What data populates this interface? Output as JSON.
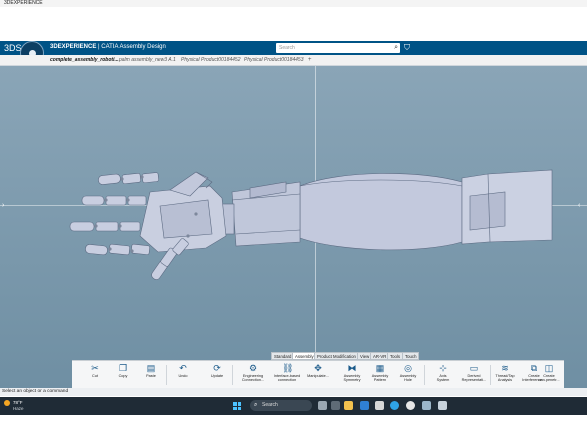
{
  "window_title": "3DEXPERIENCE",
  "header": {
    "ds_logo": "3DS",
    "brand_bold": "3DEXPERIENCE",
    "brand_rest": " | CATIA Assembly Design",
    "search_placeholder": "Search",
    "search_icon": "search-icon",
    "tag_icon": "tag-icon"
  },
  "tabs": [
    {
      "label": "complete_assembly_roboti...",
      "active": true
    },
    {
      "label": "palm assembly_new3 A.1",
      "active": false
    },
    {
      "label": "Physical Product00184452",
      "active": false
    },
    {
      "label": "Physical Product00184453",
      "active": false
    }
  ],
  "tab_add": "+",
  "action_bar_tabs": [
    "Standard",
    "Assembly",
    "Product Modification",
    "View",
    "AR-VR",
    "Tools",
    "Touch"
  ],
  "active_action_tab": "Assembly",
  "tools": [
    {
      "label": "Cut",
      "icon": "cut-icon",
      "glyph": "✂"
    },
    {
      "label": "Copy",
      "icon": "copy-icon",
      "glyph": "❐"
    },
    {
      "label": "Paste",
      "icon": "paste-icon",
      "glyph": "▤"
    },
    {
      "label": "Undo",
      "icon": "undo-icon",
      "glyph": "↶"
    },
    {
      "label": "Update",
      "icon": "update-icon",
      "glyph": "⟳"
    },
    {
      "label": "Engineering\nConnection...",
      "icon": "engineering-connection-icon",
      "glyph": "⚙"
    },
    {
      "label": "Interface-based\nconnection",
      "icon": "interface-connection-icon",
      "glyph": "⛓"
    },
    {
      "label": "Manipulate...",
      "icon": "manipulate-icon",
      "glyph": "✥"
    },
    {
      "label": "Assembly\nSymmetry",
      "icon": "assembly-symmetry-icon",
      "glyph": "⧓"
    },
    {
      "label": "Assembly\nPattern",
      "icon": "assembly-pattern-icon",
      "glyph": "▦"
    },
    {
      "label": "Assembly\nHole",
      "icon": "assembly-hole-icon",
      "glyph": "◎"
    },
    {
      "label": "Axis\nSystem",
      "icon": "axis-system-icon",
      "glyph": "⊹"
    },
    {
      "label": "Derived\nRepresentati...",
      "icon": "derived-representation-icon",
      "glyph": "▭"
    },
    {
      "label": "Thread/Tap\nAnalysis",
      "icon": "thread-tap-analysis-icon",
      "glyph": "≋"
    },
    {
      "label": "Create\nInterference...",
      "icon": "create-interference-icon",
      "glyph": "⧉"
    },
    {
      "label": "Create\nnon penetr...",
      "icon": "create-non-penetration-icon",
      "glyph": "◫"
    }
  ],
  "status_text": "Select an object or a command",
  "taskbar": {
    "temperature": "78°F",
    "weather": "Haze",
    "search_label": "Search"
  }
}
